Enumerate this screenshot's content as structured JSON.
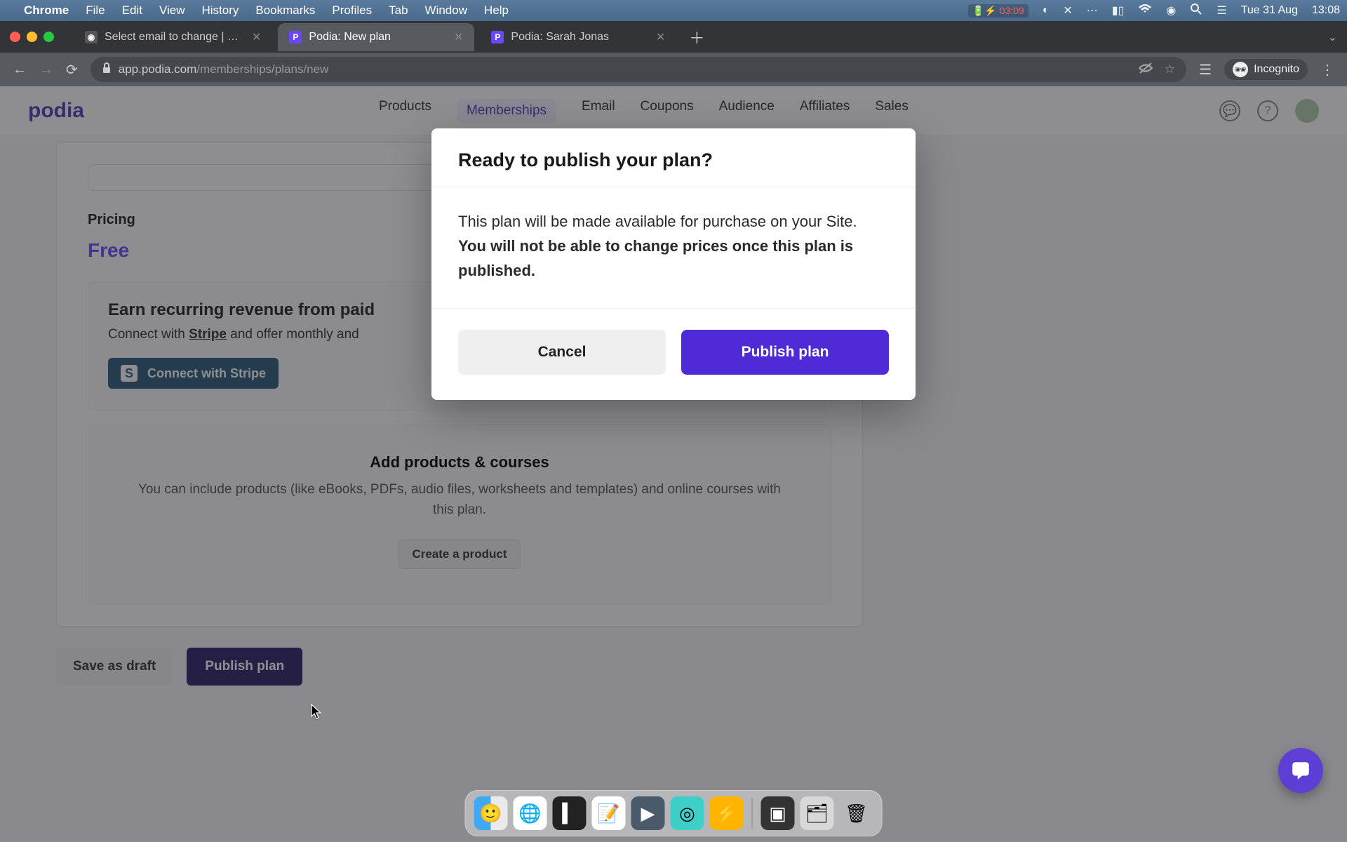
{
  "menubar": {
    "app_name": "Chrome",
    "items": [
      "File",
      "Edit",
      "View",
      "History",
      "Bookmarks",
      "Profiles",
      "Tab",
      "Window",
      "Help"
    ],
    "battery_time": "03:09",
    "date": "Tue 31 Aug",
    "time": "13:08"
  },
  "browser": {
    "tabs": [
      {
        "title": "Select email to change | Django",
        "favicon": "django",
        "active": false
      },
      {
        "title": "Podia: New plan",
        "favicon": "P",
        "active": true
      },
      {
        "title": "Podia: Sarah Jonas",
        "favicon": "P",
        "active": false
      }
    ],
    "url_host": "app.podia.com",
    "url_path": "/memberships/plans/new",
    "incognito_label": "Incognito"
  },
  "header": {
    "logo": "podia",
    "nav": [
      "Products",
      "Memberships",
      "Email",
      "Coupons",
      "Audience",
      "Affiliates",
      "Sales"
    ],
    "active_nav": "Memberships"
  },
  "page": {
    "pricing_title": "Pricing",
    "free_label": "Free",
    "earn_title": "Earn recurring revenue from paid",
    "earn_sub_prefix": "Connect with ",
    "earn_link": "Stripe",
    "earn_sub_suffix": " and offer monthly and",
    "stripe_btn": "Connect with Stripe",
    "products_title": "Add products & courses",
    "products_sub": "You can include products (like eBooks, PDFs, audio files, worksheets and templates) and online courses with this plan.",
    "create_btn": "Create a product",
    "draft_btn": "Save as draft",
    "publish_btn": "Publish plan"
  },
  "modal": {
    "title": "Ready to publish your plan?",
    "body_plain": "This plan will be made available for purchase on your Site. ",
    "body_bold": "You will not be able to change prices once this plan is published.",
    "cancel": "Cancel",
    "confirm": "Publish plan"
  }
}
